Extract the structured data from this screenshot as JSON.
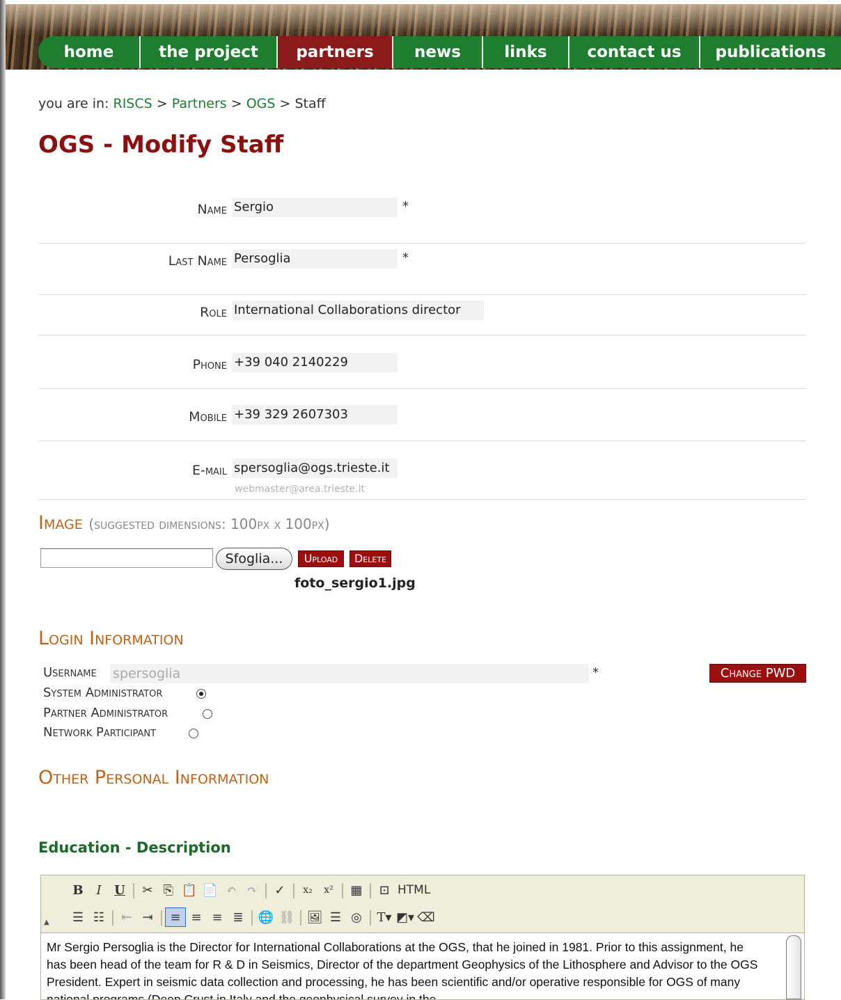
{
  "nav": {
    "items": [
      {
        "label": "home",
        "width": 147
      },
      {
        "label": "the project",
        "width": 197
      },
      {
        "label": "partners",
        "width": 166
      },
      {
        "label": "news",
        "width": 129
      },
      {
        "label": "links",
        "width": 124
      },
      {
        "label": "contact us",
        "width": 188
      },
      {
        "label": "publications",
        "width": 202
      }
    ]
  },
  "breadcrumb": {
    "prefix": "you are in:",
    "items": [
      "RISCS",
      "Partners",
      "OGS"
    ],
    "current": "Staff",
    "separator": ">"
  },
  "page_title": "OGS - Modify Staff",
  "form": {
    "name": {
      "label": "Name",
      "value": "Sergio",
      "required": "*"
    },
    "last_name": {
      "label": "Last Name",
      "value": "Persoglia",
      "required": "*"
    },
    "role": {
      "label": "Role",
      "value": "International Collaborations director"
    },
    "phone": {
      "label": "Phone",
      "value": "+39 040 2140229"
    },
    "mobile": {
      "label": "Mobile",
      "value": "+39 329 2607303"
    },
    "email": {
      "label": "E-mail",
      "value": "spersoglia@ogs.trieste.it",
      "hint": "webmaster@area.trieste.it"
    }
  },
  "image_section": {
    "heading": "Image",
    "note": "(suggested dimensions: 100px x 100px)",
    "browse_label": "Sfoglia...",
    "upload_label": "Upload",
    "delete_label": "Delete",
    "filename": "foto_sergio1.jpg"
  },
  "login": {
    "heading": "Login Information",
    "username_label": "Username",
    "username_value": "spersoglia",
    "required": "*",
    "change_pwd_label": "Change PWD",
    "roles": [
      {
        "label": "System Administrator",
        "checked": true
      },
      {
        "label": "Partner Administrator",
        "checked": false
      },
      {
        "label": "Network Participant",
        "checked": false
      }
    ]
  },
  "other": {
    "heading": "Other Personal Information",
    "education_heading": "Education - Description"
  },
  "editor": {
    "html_label": "HTML",
    "text": "Mr Sergio Persoglia is the Director for International Collaborations at the OGS, that he joined in 1981. Prior to this assignment, he has been head of the team for R & D in Seismics, Director of the department Geophysics of the Lithosphere and Advisor to the OGS President. Expert in seismic data collection and processing, he has been scientific and/or operative responsible for OGS of many national programs (Deep Crust in Italy and the geophysical survey in the"
  },
  "colors": {
    "nav_green": "#1e7d2e",
    "nav_active": "#8b1a1a",
    "title_red": "#8b1010",
    "section_orange": "#c0621a",
    "link_green": "#1e7d2e"
  }
}
